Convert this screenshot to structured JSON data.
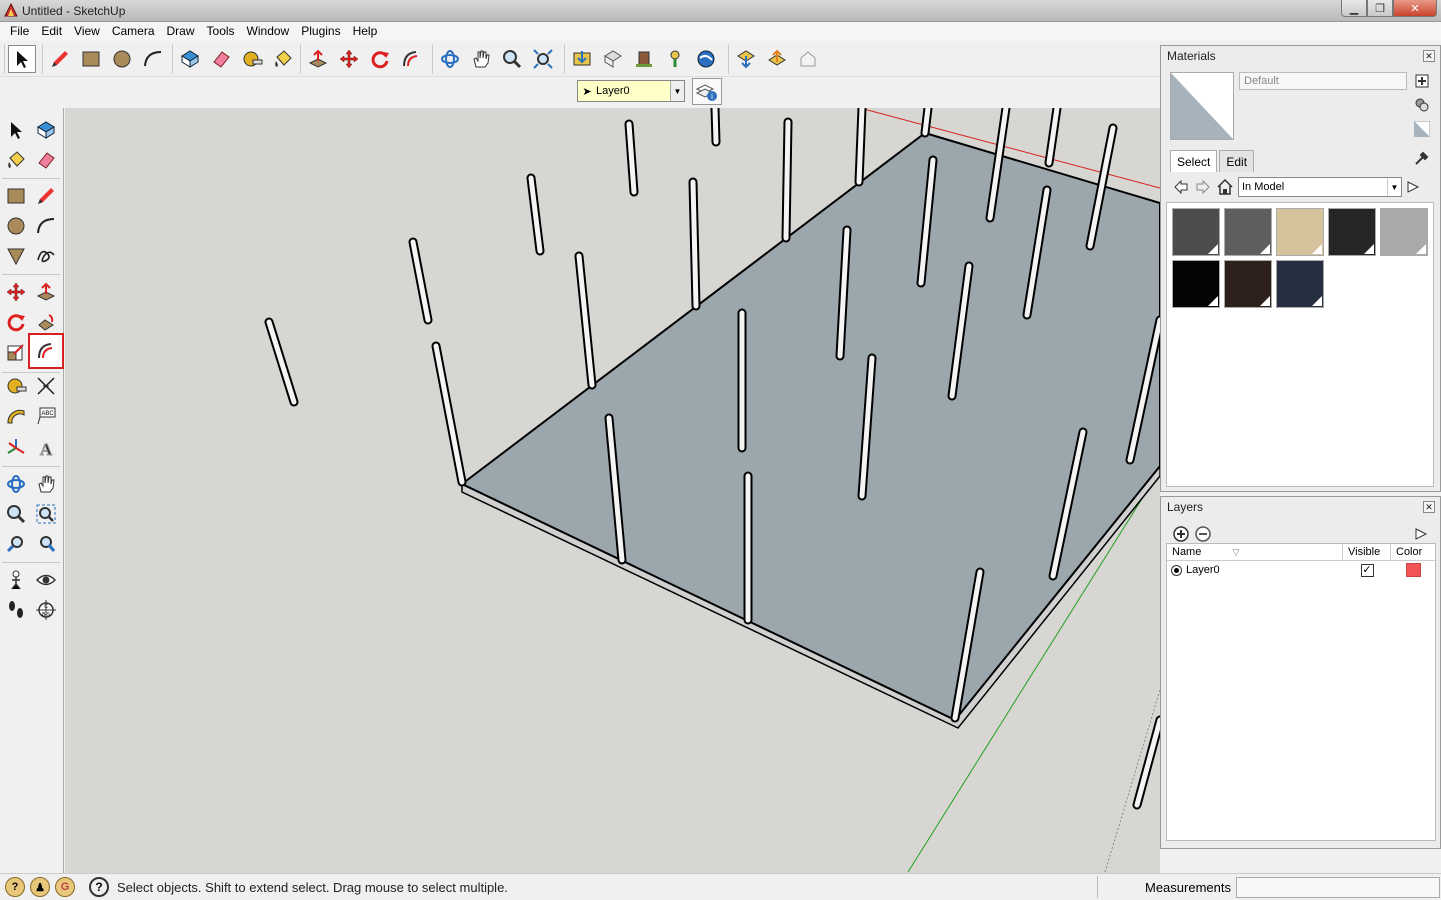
{
  "window": {
    "title": "Untitled - SketchUp",
    "minimize_icon": "minimize-icon",
    "maximize_icon": "maximize-icon",
    "close_icon": "close-icon"
  },
  "menu": [
    "File",
    "Edit",
    "View",
    "Camera",
    "Draw",
    "Tools",
    "Window",
    "Plugins",
    "Help"
  ],
  "top_toolbar": {
    "groups": [
      [
        "select-icon"
      ],
      [
        "pencil-icon",
        "rectangle-icon",
        "circle-icon",
        "arc-icon"
      ],
      [
        "make-component-icon",
        "eraser-icon",
        "tape-measure-icon",
        "paint-bucket-icon"
      ],
      [
        "push-pull-icon",
        "move-icon",
        "rotate-icon",
        "follow-me-icon"
      ],
      [
        "orbit-icon",
        "pan-icon",
        "zoom-icon",
        "zoom-extents-icon"
      ],
      [
        "get-models-icon",
        "share-model-icon",
        "share-component-icon",
        "place-model-icon",
        "google-earth-icon"
      ],
      [
        "get-photo-texture-icon",
        "upload-icon",
        "preview-icon"
      ]
    ]
  },
  "layer_toolbar": {
    "current_layer": "Layer0",
    "manager_icon": "layer-manager-icon"
  },
  "left_toolbar": {
    "selected": "follow-me-icon",
    "tools": [
      "select-icon",
      "make-component-icon",
      "paint-bucket-icon",
      "eraser-icon",
      "rectangle-icon",
      "pencil-icon",
      "circle-icon",
      "arc-icon",
      "polygon-icon",
      "freehand-icon",
      "move-icon",
      "push-pull-icon",
      "rotate-icon",
      "follow-me-rotate-icon",
      "scale-icon",
      "follow-me-icon",
      "tape-measure-icon",
      "dimension-icon",
      "protractor-icon",
      "text-icon",
      "axes-icon",
      "3d-text-icon",
      "orbit-icon",
      "pan-icon",
      "zoom-icon",
      "zoom-window-icon",
      "previous-view-icon",
      "zoom-extents-icon",
      "position-camera-icon",
      "look-around-icon",
      "walk-icon",
      "section-plane-icon"
    ]
  },
  "materials": {
    "title": "Materials",
    "name_value": "Default",
    "tabs": [
      "Select",
      "Edit"
    ],
    "active_tab": "Select",
    "collection": "In Model",
    "swatches": [
      "#4d4d4d",
      "#5e5e5e",
      "#d6c29b",
      "#262626",
      "#a9a9a9",
      "#050505",
      "#2e211d",
      "#242f3f"
    ],
    "preview_color": "#a6b3bc"
  },
  "layers": {
    "title": "Layers",
    "columns": [
      "Name",
      "Visible",
      "Color"
    ],
    "rows": [
      {
        "name": "Layer0",
        "visible": true,
        "color": "#f05454"
      }
    ]
  },
  "status": {
    "message": "Select objects. Shift to extend select. Drag mouse to select multiple.",
    "measurements_label": "Measurements",
    "measurements_value": ""
  },
  "colors": {
    "viewport_bg": "#d7d6d2",
    "floor": "#9ba6ad",
    "axis_red": "#d02020",
    "axis_green": "#20a020"
  }
}
